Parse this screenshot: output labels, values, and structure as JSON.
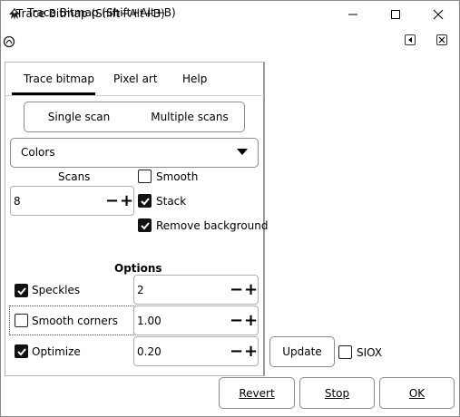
{
  "window": {
    "title": "Trace Bitmap (Shift+Alt+B)",
    "dock_title": "Trace Bitmap (Shift+Alt+B)"
  },
  "tabs": [
    "Trace bitmap",
    "Pixel art",
    "Help"
  ],
  "scan_mode": {
    "single": "Single scan",
    "multiple": "Multiple scans"
  },
  "mode_select": {
    "value": "Colors"
  },
  "scans": {
    "label": "Scans",
    "value": "8"
  },
  "options_right": {
    "smooth": {
      "label": "Smooth",
      "checked": false
    },
    "stack": {
      "label": "Stack",
      "checked": true
    },
    "remove_background": {
      "label": "Remove background",
      "checked": true
    }
  },
  "options": {
    "heading": "Options",
    "speckles": {
      "label": "Speckles",
      "checked": true,
      "value": "2"
    },
    "smooth_corners": {
      "label": "Smooth corners",
      "checked": false,
      "value": "1.00"
    },
    "optimize": {
      "label": "Optimize",
      "checked": true,
      "value": "0.20"
    }
  },
  "preview": {
    "update": "Update",
    "siox": {
      "label": "SIOX",
      "checked": false
    }
  },
  "footer": {
    "revert": "Revert",
    "stop": "Stop",
    "ok": "OK"
  },
  "glyphs": {
    "minus": "−",
    "plus": "+",
    "check": "✓"
  }
}
